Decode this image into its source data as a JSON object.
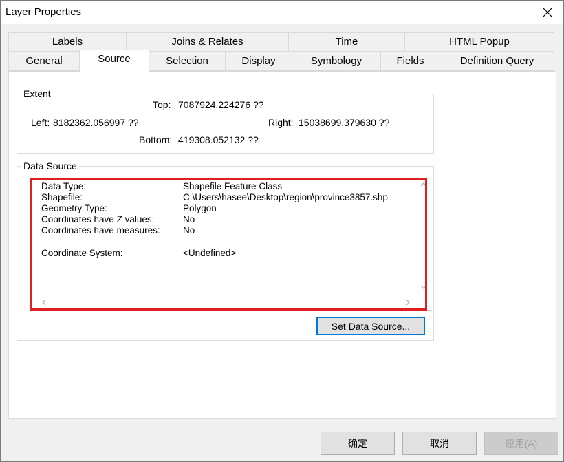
{
  "window": {
    "title": "Layer Properties"
  },
  "tabs_row1": [
    "Labels",
    "Joins & Relates",
    "Time",
    "HTML Popup"
  ],
  "tabs_row2": [
    "General",
    "Source",
    "Selection",
    "Display",
    "Symbology",
    "Fields",
    "Definition Query"
  ],
  "active_tab": "Source",
  "extent": {
    "legend": "Extent",
    "top_label": "Top:",
    "top_value": "7087924.224276 ??",
    "left_label": "Left:",
    "left_value": "8182362.056997 ??",
    "right_label": "Right:",
    "right_value": "15038699.379630 ??",
    "bottom_label": "Bottom:",
    "bottom_value": "419308.052132 ??"
  },
  "data_source": {
    "legend": "Data Source",
    "rows": [
      {
        "key": "Data Type:",
        "value": "Shapefile Feature Class"
      },
      {
        "key": "Shapefile:",
        "value": "C:\\Users\\hasee\\Desktop\\region\\province3857.shp"
      },
      {
        "key": "Geometry Type:",
        "value": "Polygon"
      },
      {
        "key": "Coordinates have Z values:",
        "value": "No"
      },
      {
        "key": "Coordinates have measures:",
        "value": "No"
      },
      {
        "key": "Coordinate System:",
        "value": "<Undefined>"
      }
    ],
    "set_button": "Set Data Source..."
  },
  "buttons": {
    "ok": "确定",
    "cancel": "取消",
    "apply": "应用(A)"
  },
  "colors": {
    "highlight": "#e02020",
    "focus": "#0078d7"
  }
}
